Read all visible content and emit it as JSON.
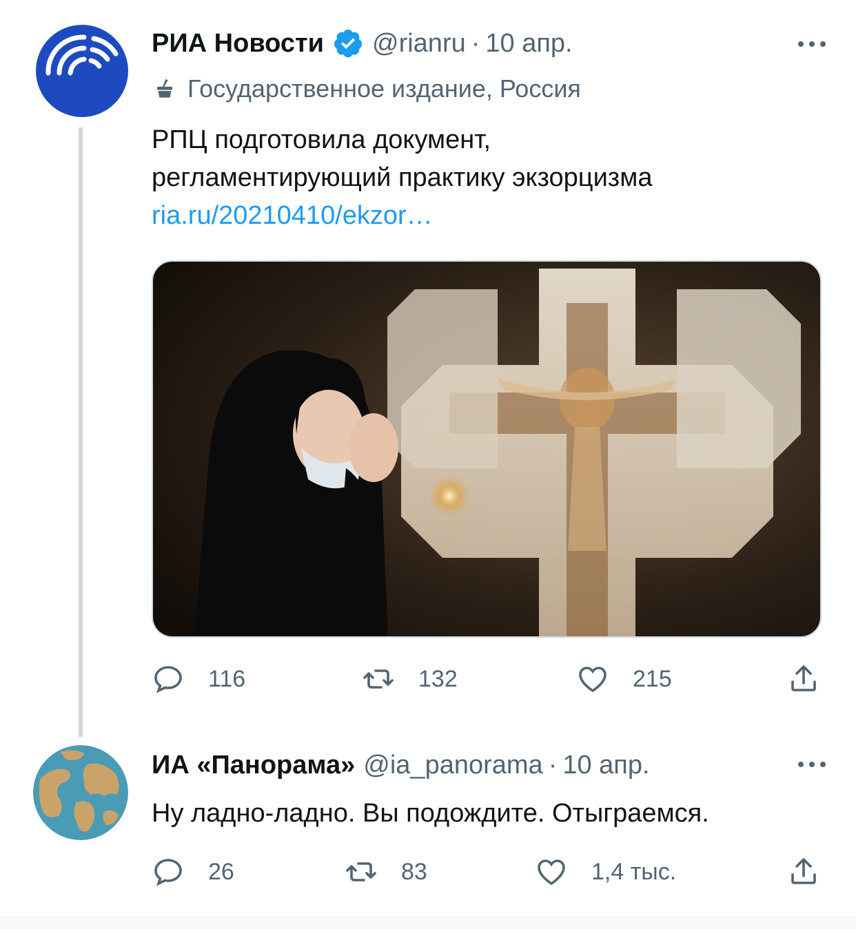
{
  "tweet1": {
    "name": "РИА Новости",
    "handle": "@rianru",
    "dot": "·",
    "date": "10 апр.",
    "label": "Государственное издание, Россия",
    "text_line1": "РПЦ подготовила документ,",
    "text_line2": "регламентирующий практику экзорцизма",
    "link": "ria.ru/20210410/ekzor…",
    "replies": "116",
    "retweets": "132",
    "likes": "215"
  },
  "tweet2": {
    "name": "ИА «Панорама»",
    "handle": "@ia_panorama",
    "dot": "·",
    "date": "10 апр.",
    "text": "Ну ладно-ладно. Вы подождите. Отыграемся.",
    "replies": "26",
    "retweets": "83",
    "likes": "1,4 тыс."
  },
  "colors": {
    "text": "#0f1419",
    "secondary": "#536471",
    "link": "#1d9bf0",
    "verified": "#1d9bf0",
    "border": "#cfd9de"
  },
  "icons": [
    "verified-badge-icon",
    "more-icon",
    "state-media-icon",
    "reply-icon",
    "retweet-icon",
    "like-icon",
    "share-icon"
  ]
}
